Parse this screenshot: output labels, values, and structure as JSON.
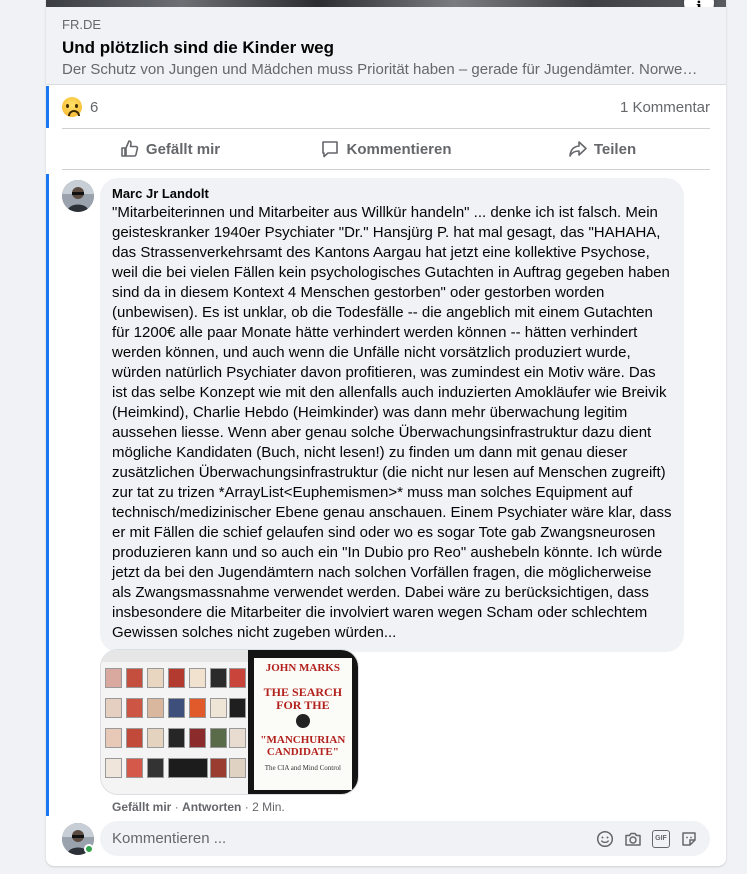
{
  "link_preview": {
    "domain": "FR.DE",
    "title": "Und plötzlich sind die Kinder weg",
    "description": "Der Schutz von Jungen und Mädchen muss Priorität haben – gerade für Jugendämter. Norwegi…"
  },
  "info_icon": "info-icon",
  "reactions": {
    "emoji": "sad-reaction-icon",
    "count": "6",
    "comments": "1 Kommentar"
  },
  "actions": {
    "like": "Gefällt mir",
    "comment": "Kommentieren",
    "share": "Teilen"
  },
  "comment": {
    "author": "Marc Jr Landolt",
    "text": "\"Mitarbeiterinnen und Mitarbeiter aus Willkür handeln\" ... denke ich ist falsch. Mein geisteskranker 1940er Psychiater \"Dr.\" Hansjürg P. hat mal gesagt, das \"HAHAHA, das Strassenverkehrsamt des Kantons Aargau hat jetzt eine kollektive Psychose, weil die bei vielen Fällen kein psychologisches Gutachten in Auftrag gegeben haben sind da in diesem Kontext 4 Menschen gestorben\" oder gestorben worden (unbewisen). Es ist unklar, ob die Todesfälle -- die angeblich mit einem Gutachten für 1200€ alle paar Monate hätte verhindert werden können -- hätten verhindert werden können, und auch wenn die Unfälle nicht vorsätzlich produziert wurde, würden natürlich Psychiater davon profitieren, was zumindest ein Motiv wäre. Das ist das selbe Konzept wie mit den allenfalls auch induzierten Amokläufer wie Breivik (Heimkind), Charlie Hebdo (Heimkinder) was dann mehr überwachung legitim aussehen liesse. Wenn aber genau solche Überwachungsinfrastruktur dazu dient mögliche Kandidaten (Buch, nicht lesen!) zu finden um dann mit genau dieser zusätzlichen Überwachungsinfrastruktur (die nicht nur lesen auf Menschen zugreift) zur tat zu trizen *ArrayList<Euphemismen>* muss man solches Equipment auf technisch/medizinischer Ebene genau anschauen. Einem Psychiater wäre klar, dass er mit Fällen die schief gelaufen sind oder wo es sogar Tote gab Zwangsneurosen produzieren kann und so auch ein \"In Dubio pro Reo\" aushebeln könnte. Ich würde jetzt da bei den Jugendämtern nach solchen Vorfällen fragen, die möglicherweise als Zwangsmassnahme verwendet werden. Dabei wäre zu berücksichtigen, dass insbesondere die Mitarbeiter die involviert waren wegen Scham oder schlechtem Gewissen solches nicht zugeben würden...",
    "attachment": {
      "book_author": "JOHN MARKS",
      "book_title_1": "THE SEARCH FOR THE",
      "book_title_2": "\"MANCHURIAN CANDIDATE\"",
      "book_subtitle": "The CIA and Mind Control"
    },
    "meta": {
      "like": "Gefällt mir",
      "reply": "Antworten",
      "time": "2 Min."
    }
  },
  "composer": {
    "placeholder": "Kommentieren ...",
    "icons": [
      "emoji-icon",
      "camera-icon",
      "gif-icon",
      "sticker-icon"
    ]
  },
  "colors": {
    "accent": "#1877f2",
    "secondary_text": "#65676b",
    "bubble": "#f0f2f5",
    "online": "#31a24c"
  }
}
